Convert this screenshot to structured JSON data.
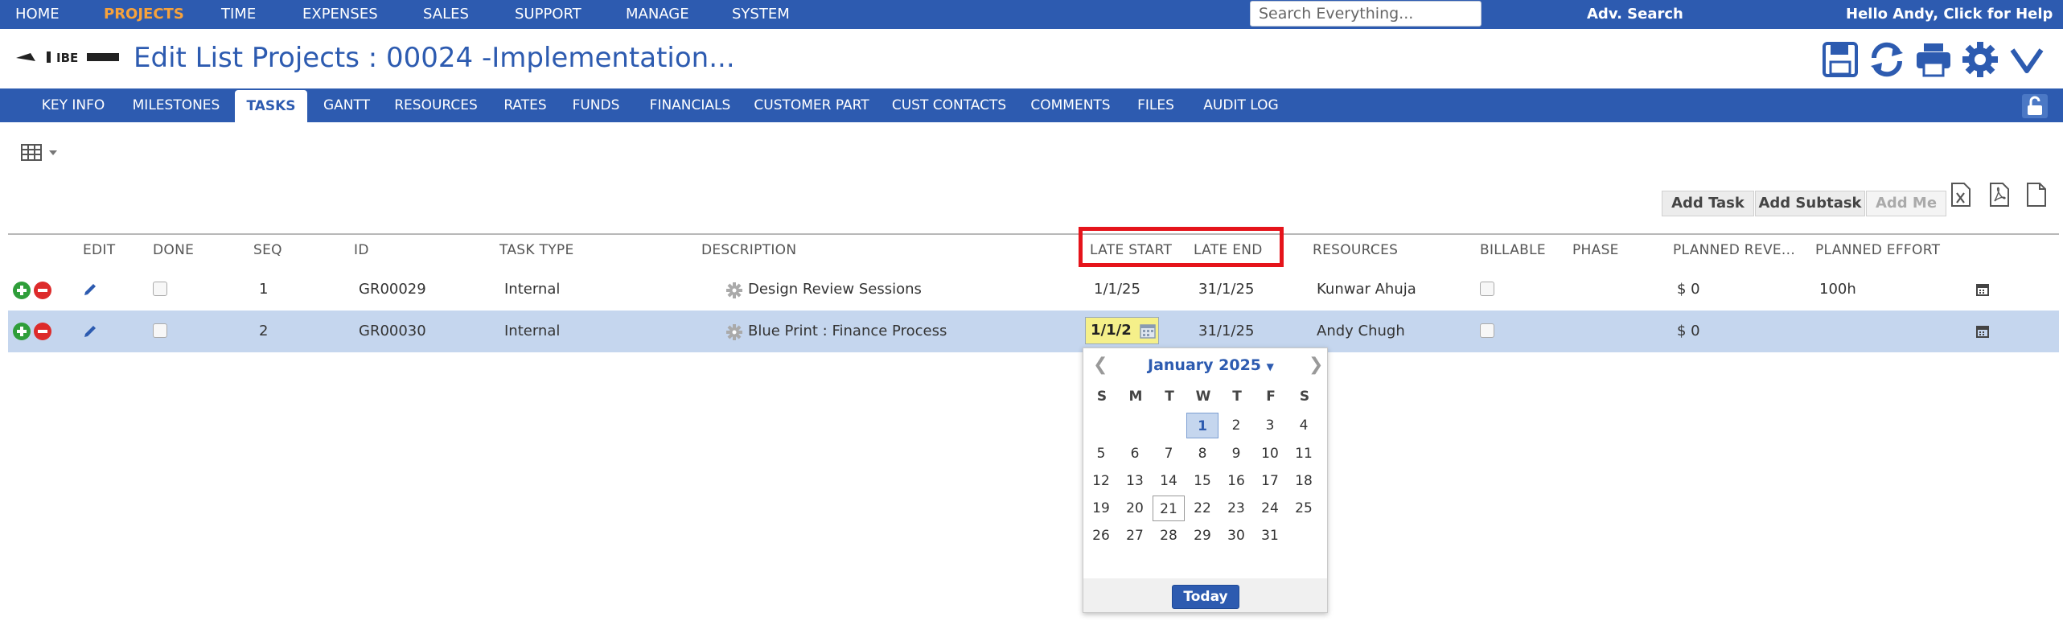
{
  "topnav": {
    "items": [
      "HOME",
      "PROJECTS",
      "TIME",
      "EXPENSES",
      "SALES",
      "SUPPORT",
      "MANAGE",
      "SYSTEM"
    ],
    "active": "PROJECTS",
    "search_placeholder": "Search Everything...",
    "adv_search": "Adv. Search",
    "greeting": "Hello Andy, Click for Help"
  },
  "header": {
    "logo_text": "IBE",
    "title": "Edit List Projects : 00024 -Implementation...",
    "toolbar_icons": [
      "save-icon",
      "refresh-icon",
      "print-icon",
      "gear-icon",
      "chevron-down-icon"
    ]
  },
  "tabs": [
    "KEY INFO",
    "MILESTONES",
    "TASKS",
    "GANTT",
    "RESOURCES",
    "RATES",
    "FUNDS",
    "FINANCIALS",
    "CUSTOMER PART",
    "CUST CONTACTS",
    "COMMENTS",
    "FILES",
    "AUDIT LOG"
  ],
  "active_tab": "TASKS",
  "actions": {
    "add_task": "Add Task",
    "add_subtask": "Add Subtask",
    "add_me": "Add Me",
    "export_icons": [
      "excel-icon",
      "pdf-icon",
      "document-icon"
    ]
  },
  "grid": {
    "columns": [
      "EDIT",
      "DONE",
      "SEQ",
      "ID",
      "TASK TYPE",
      "DESCRIPTION",
      "LATE START",
      "LATE END",
      "RESOURCES",
      "BILLABLE",
      "PHASE",
      "PLANNED REVE...",
      "PLANNED EFFORT"
    ],
    "rows": [
      {
        "seq": "1",
        "id": "GR00029",
        "task_type": "Internal",
        "description": "Design Review Sessions",
        "late_start": "1/1/25",
        "late_end": "31/1/25",
        "resources": "Kunwar Ahuja",
        "phase": "",
        "planned_revenue": "$ 0",
        "planned_effort": "100h"
      },
      {
        "seq": "2",
        "id": "GR00030",
        "task_type": "Internal",
        "description": "Blue Print : Finance Process",
        "late_start": "1/1/2",
        "late_end": "31/1/25",
        "resources": "Andy Chugh",
        "phase": "",
        "planned_revenue": "$ 0",
        "planned_effort": ""
      }
    ]
  },
  "datepicker": {
    "month_label": "January 2025",
    "prev": "❮",
    "next": "❯",
    "weekdays": [
      "S",
      "M",
      "T",
      "W",
      "T",
      "F",
      "S"
    ],
    "weeks": [
      [
        "",
        "",
        "",
        "1",
        "2",
        "3",
        "4"
      ],
      [
        "5",
        "6",
        "7",
        "8",
        "9",
        "10",
        "11"
      ],
      [
        "12",
        "13",
        "14",
        "15",
        "16",
        "17",
        "18"
      ],
      [
        "19",
        "20",
        "21",
        "22",
        "23",
        "24",
        "25"
      ],
      [
        "26",
        "27",
        "28",
        "29",
        "30",
        "31",
        ""
      ]
    ],
    "selected_day": "1",
    "today_day": "21",
    "today_label": "Today"
  },
  "colors": {
    "brand_blue": "#2d5bb0",
    "active_nav": "#f7a23b",
    "selected_row": "#c5d6ee",
    "highlight_box": "#e5141b",
    "date_input_bg": "#f5f08a"
  }
}
